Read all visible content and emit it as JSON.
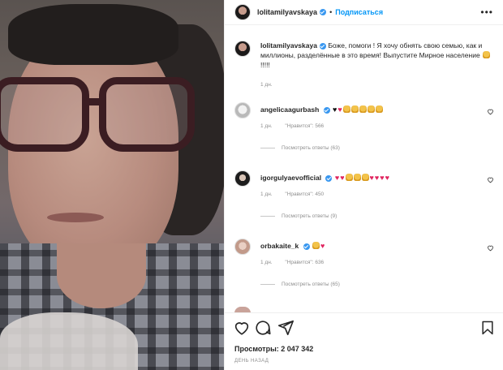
{
  "post": {
    "username": "lolitamilyavskaya",
    "separator": "•",
    "follow_label": "Подписаться",
    "more_label": "•••",
    "caption_text": "Боже, помоги ! Я хочу обнять свою семью, как и миллионы, разделённые в это время! Выпустите Мирное население",
    "caption_suffix": "!!!!!",
    "caption_time": "1 дн.",
    "views_label": "Просмотры: 2 047 342",
    "date_label": "ДЕНЬ НАЗАД"
  },
  "comments": [
    {
      "username": "angelicaagurbash",
      "emoji": [
        "bheart",
        "heart",
        "pray",
        "pray",
        "pray",
        "pray",
        "pray"
      ],
      "time": "1 дн.",
      "likes": "\"Нравится\": 566",
      "replies": "Посмотреть ответы (63)"
    },
    {
      "username": "igorgulyaevofficial",
      "emoji": [
        "heart",
        "heart",
        "pray",
        "pray",
        "pray",
        "heart",
        "heart",
        "heart",
        "heart"
      ],
      "time": "1 дн.",
      "likes": "\"Нравится\": 450",
      "replies": "Посмотреть ответы (9)"
    },
    {
      "username": "orbakaite_k",
      "emoji": [
        "pray",
        "heart"
      ],
      "time": "1 дн.",
      "likes": "\"Нравится\": 636",
      "replies": "Посмотреть ответы (65)"
    }
  ],
  "colors": {
    "link_blue": "#0095f6",
    "verified_blue": "#3897f0",
    "muted_text": "#8e8e8e",
    "heart_red": "#e0245e"
  },
  "icons": [
    "heart-icon",
    "comment-icon",
    "share-icon",
    "bookmark-icon",
    "more-icon",
    "verified-badge-icon"
  ]
}
